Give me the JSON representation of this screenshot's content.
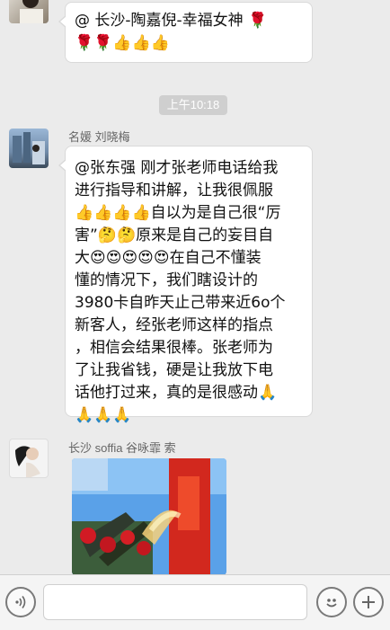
{
  "messages": [
    {
      "sender": "",
      "lines": [
        "@ 长沙-陶嘉倪-幸福女神 🌹",
        "🌹🌹👍👍👍"
      ]
    }
  ],
  "timestamp": "上午10:18",
  "msg2": {
    "sender": "名媛 刘晓梅",
    "lines": [
      "@张东强 刚才张老师电话给我",
      "进行指导和讲解，让我很佩服",
      "👍👍👍👍自以为是自己很“厉",
      "害”🤔🤔原来是自己的妄目自",
      "大😍😍😍😍😍在自己不懂装",
      "懂的情况下，我们瞎设计的",
      "3980卡自昨天止己带来近6o个",
      "新客人，经张老师这样的指点",
      "，相信会结果很棒。张老师为",
      "了让我省钱，硬是让我放下电",
      "话他打过来，真的是很感动🙏",
      "🙏🙏🙏"
    ]
  },
  "msg3": {
    "sender": "长沙 soffia 谷咏霏 索"
  },
  "icons": {
    "voice": "voice-icon",
    "emoji": "emoji-icon",
    "plus": "plus-icon"
  }
}
